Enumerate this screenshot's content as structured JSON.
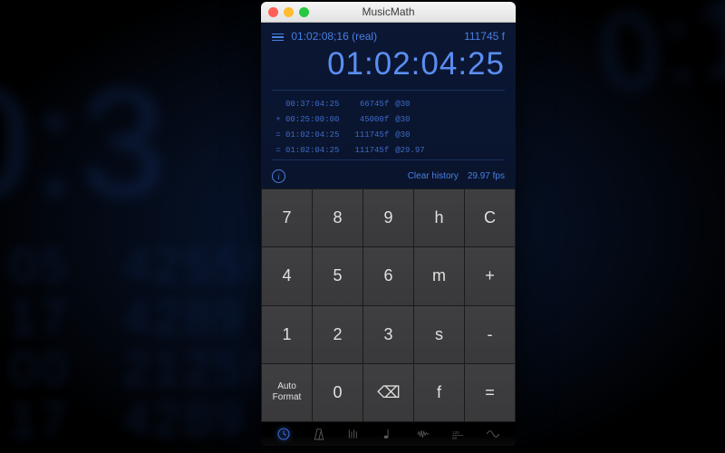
{
  "window": {
    "title": "MusicMath"
  },
  "display": {
    "real_label": "01:02:08;16 (real)",
    "frames": "111745 f",
    "main_readout": "01:02:04:25",
    "history": [
      {
        "op": "",
        "tc": "00:37:04:25",
        "frames": "66745f",
        "at": "@30"
      },
      {
        "op": "+",
        "tc": "00:25:00:00",
        "frames": "45000f",
        "at": "@30"
      },
      {
        "op": "=",
        "tc": "01:02:04:25",
        "frames": "111745f",
        "at": "@30"
      },
      {
        "op": "=",
        "tc": "01:02:04:25",
        "frames": "111745f",
        "at": "@29.97"
      }
    ],
    "clear_history": "Clear history",
    "fps_label": "29.97 fps"
  },
  "keypad": {
    "rows": [
      [
        "7",
        "8",
        "9",
        "h",
        "C"
      ],
      [
        "4",
        "5",
        "6",
        "m",
        "+"
      ],
      [
        "1",
        "2",
        "3",
        "s",
        "-"
      ],
      [
        "Auto\nFormat",
        "0",
        "⌫",
        "f",
        "="
      ]
    ]
  },
  "toolbar": {
    "items": [
      "clock",
      "metronome",
      "bars",
      "note",
      "wave",
      "levels",
      "sine"
    ]
  },
  "colors": {
    "accent": "#4a7fe0",
    "key_bg": "#3d3d3f"
  }
}
